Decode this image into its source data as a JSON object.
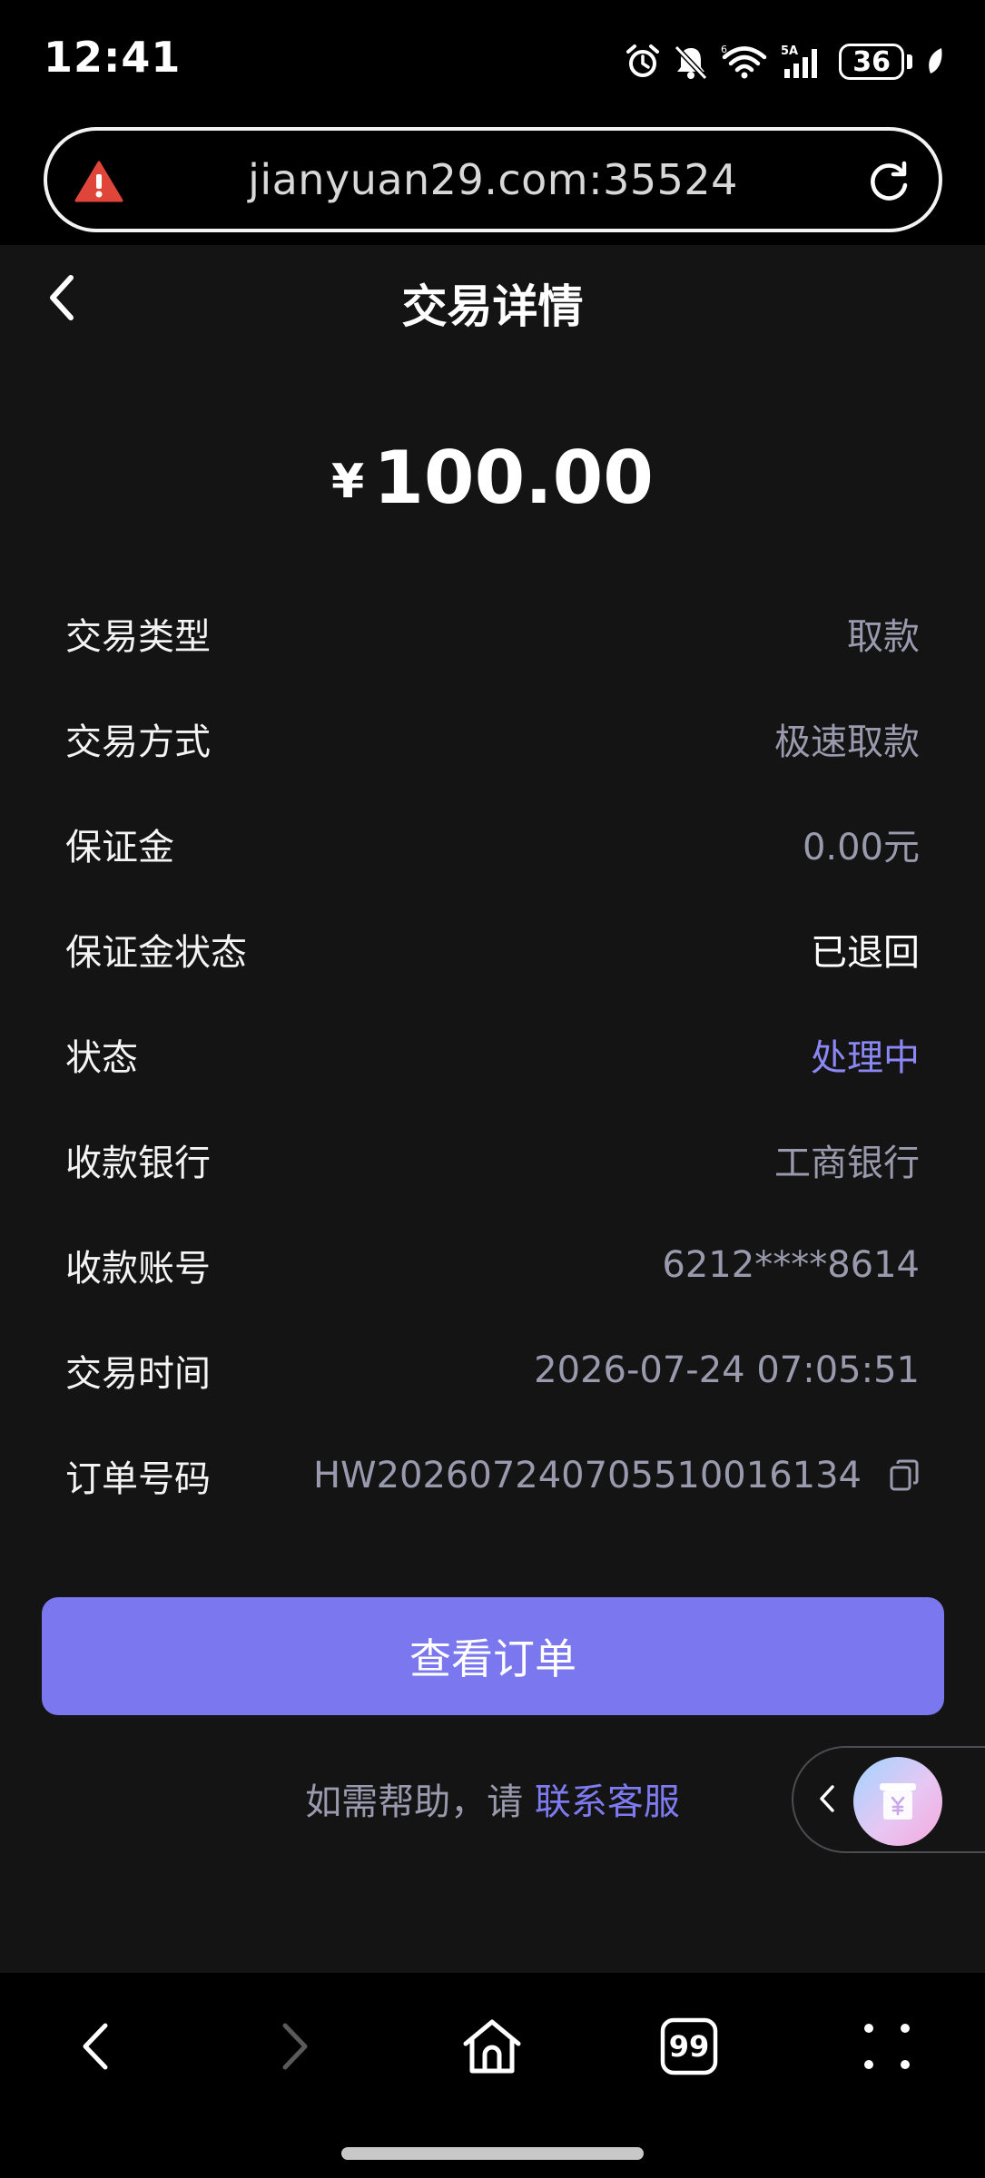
{
  "status_bar": {
    "time": "12:41",
    "battery": "36",
    "network_label": "5A",
    "wifi_label": "6"
  },
  "url_bar": {
    "url": "jianyuan29.com:35524",
    "warning_color": "#e0453a"
  },
  "header": {
    "title": "交易详情"
  },
  "amount": {
    "currency": "¥",
    "value": "100.00"
  },
  "details": [
    {
      "label": "交易类型",
      "value": "取款"
    },
    {
      "label": "交易方式",
      "value": "极速取款"
    },
    {
      "label": "保证金",
      "value": "0.00元"
    },
    {
      "label": "保证金状态",
      "value": "已退回"
    },
    {
      "label": "状态",
      "value": "处理中"
    },
    {
      "label": "收款银行",
      "value": "工商银行"
    },
    {
      "label": "收款账号",
      "value": "6212****8614"
    },
    {
      "label": "交易时间",
      "value": "2026-07-24 07:05:51"
    },
    {
      "label": "订单号码",
      "value": "HW20260724070551001613 4"
    }
  ],
  "order_number": "HW202607240705510016134",
  "actions": {
    "view_order_label": "查看订单",
    "help_prefix": "如需帮助，请 ",
    "help_link": "联系客服"
  },
  "bottom_bar": {
    "tab_count": "99"
  },
  "colors": {
    "accent": "#7b78ef",
    "page_background": "#141414",
    "muted_text": "#9a9aae"
  }
}
